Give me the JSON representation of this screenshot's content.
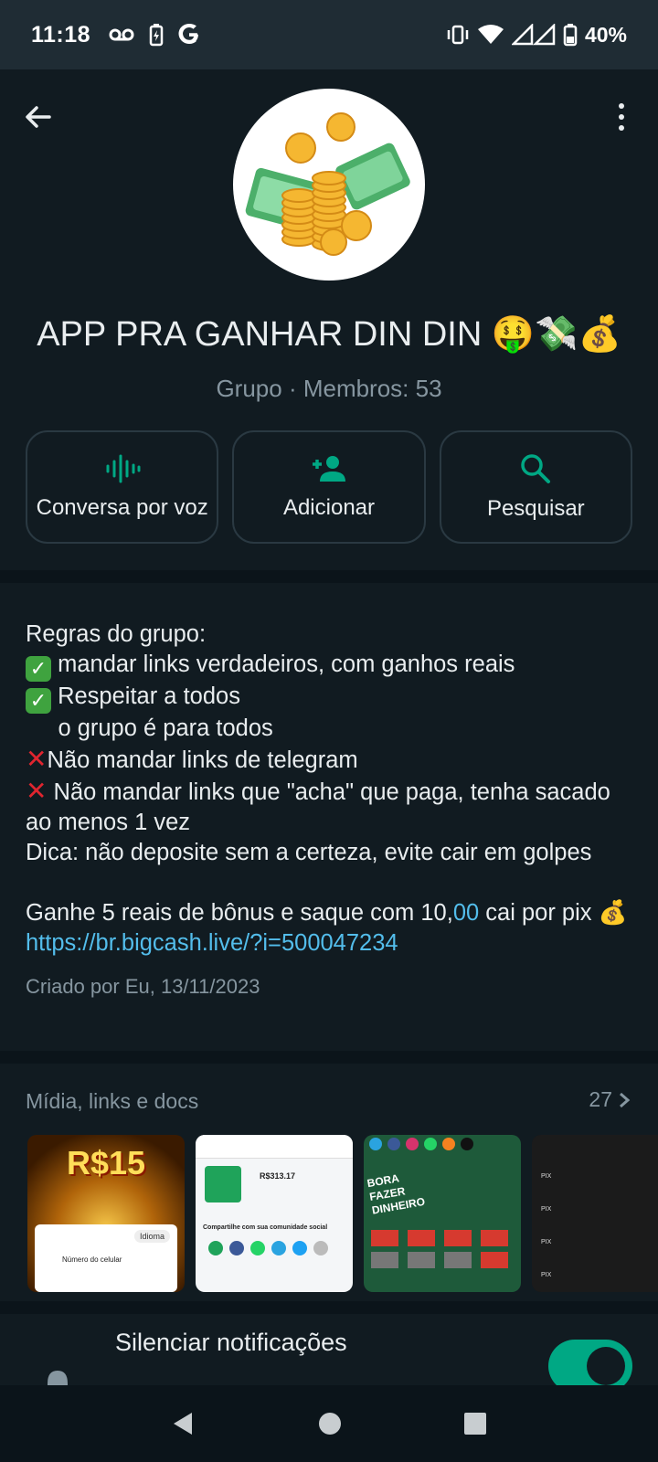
{
  "status_bar": {
    "time": "11:18",
    "battery": "40%",
    "icons": [
      "voicemail-icon",
      "battery-saver-icon",
      "google-icon",
      "vibrate-icon",
      "wifi-icon",
      "signal-icon",
      "battery-icon"
    ]
  },
  "header": {
    "group_name": "APP PRA GANHAR DIN DIN 🤑💸💰",
    "subtitle": "Grupo · Membros: 53",
    "actions": [
      {
        "label": "Conversa por voz",
        "icon": "voice-chat-icon"
      },
      {
        "label": "Adicionar",
        "icon": "add-person-icon"
      },
      {
        "label": "Pesquisar",
        "icon": "search-icon"
      }
    ]
  },
  "description": {
    "line1": "Regras do grupo:",
    "line2": " mandar links verdadeiros, com ganhos reais",
    "line3": " Respeitar a todos",
    "line4": "     o grupo é para todos",
    "line5": "Não mandar links de telegram",
    "line6": " Não mandar links que \"acha\" que paga, tenha sacado ao menos 1 vez",
    "line7": "Dica: não deposite sem a certeza, evite cair em golpes",
    "line8_pre": "Ganhe 5 reais de bônus e saque com 10,",
    "line8_num": "00",
    "line8_post": " cai por pix 💰 ",
    "link": "https://br.bigcash.live/?i=500047234",
    "created": "Criado por Eu, 13/11/2023"
  },
  "media": {
    "title": "Mídia, links e docs",
    "count": "27",
    "thumb1_text": "R$15",
    "thumb1_label": "Idioma",
    "thumb1_field": "Número do celular",
    "thumb2_value": "R$313.17",
    "thumb2_share": "Compartilhe com sua comunidade social",
    "thumb3_text": "BORA FAZER DINHEIRO",
    "thumb4_label": "PIX"
  },
  "notifications": {
    "label": "Silenciar notificações",
    "enabled": true
  },
  "colors": {
    "accent": "#00a884",
    "link": "#53bdeb",
    "bg": "#111b21",
    "muted": "#8696a0"
  }
}
